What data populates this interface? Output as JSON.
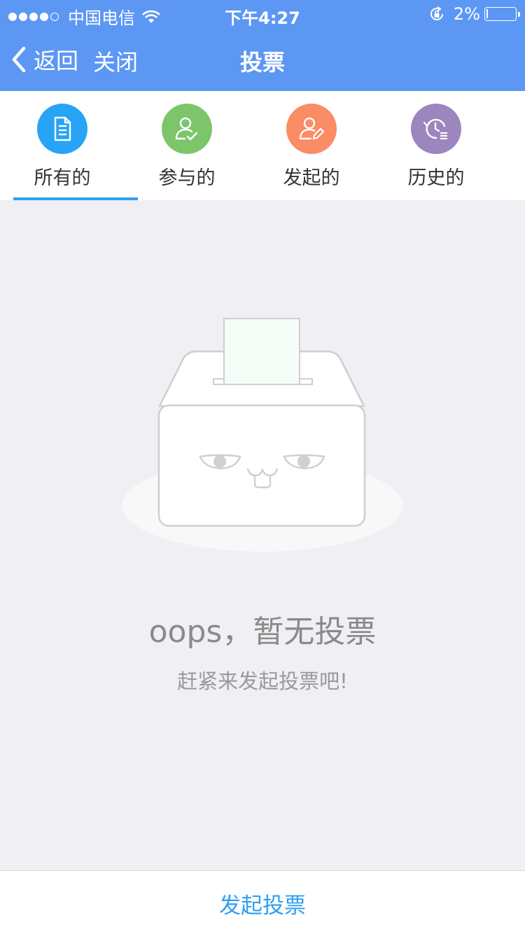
{
  "status_bar": {
    "carrier": "中国电信",
    "time": "下午4:27",
    "battery_percent": "2%",
    "battery_level": 0.02,
    "signal_bars_filled": 4,
    "signal_bars_total": 5
  },
  "nav": {
    "back_label": "返回",
    "close_label": "关闭",
    "title": "投票"
  },
  "tabs": [
    {
      "label": "所有的",
      "icon": "document-icon",
      "color": "#27a4f5",
      "active": true
    },
    {
      "label": "参与的",
      "icon": "user-check-icon",
      "color": "#7dc56b",
      "active": false
    },
    {
      "label": "发起的",
      "icon": "user-edit-icon",
      "color": "#fa8c66",
      "active": false
    },
    {
      "label": "历史的",
      "icon": "history-icon",
      "color": "#9c86bd",
      "active": false
    }
  ],
  "empty_state": {
    "title": "oops，暂无投票",
    "subtitle": "赶紧来发起投票吧!"
  },
  "bottom": {
    "start_vote_label": "发起投票"
  },
  "colors": {
    "header": "#5d97f4",
    "accent": "#2e9ff1",
    "background": "#efeff4"
  }
}
